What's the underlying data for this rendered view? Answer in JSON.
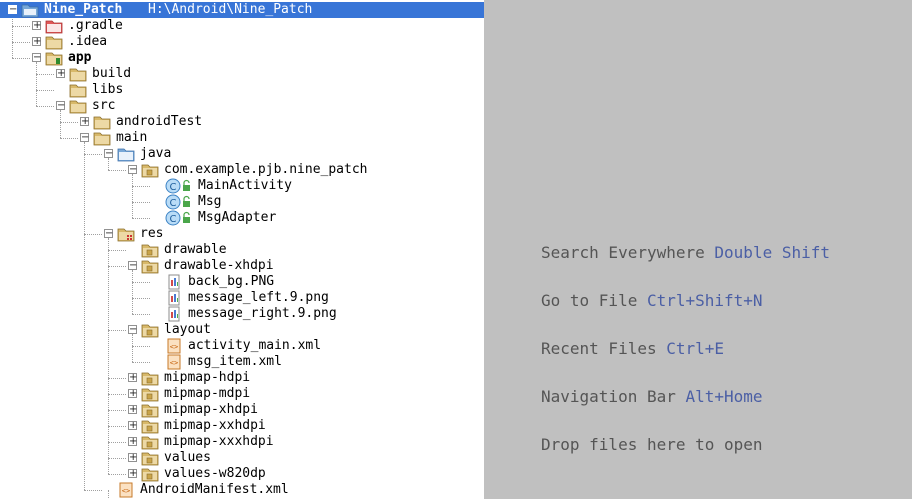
{
  "project": {
    "name": "Nine_Patch",
    "path": "H:\\Android\\Nine_Patch"
  },
  "tree": [
    {
      "label": "Nine_Patch",
      "depth": 0,
      "icon": "project-folder-icon",
      "toggle": "minus",
      "selected": true,
      "bold": true,
      "path": "H:\\Android\\Nine_Patch"
    },
    {
      "label": ".gradle",
      "depth": 1,
      "icon": "folder-red-icon",
      "toggle": "plus"
    },
    {
      "label": ".idea",
      "depth": 1,
      "icon": "folder-icon",
      "toggle": "plus"
    },
    {
      "label": "app",
      "depth": 1,
      "icon": "module-folder-icon",
      "toggle": "minus",
      "bold": true
    },
    {
      "label": "build",
      "depth": 2,
      "icon": "folder-icon",
      "toggle": "plus"
    },
    {
      "label": "libs",
      "depth": 2,
      "icon": "folder-icon",
      "toggle": "none"
    },
    {
      "label": "src",
      "depth": 2,
      "icon": "folder-icon",
      "toggle": "minus"
    },
    {
      "label": "androidTest",
      "depth": 3,
      "icon": "folder-icon",
      "toggle": "plus"
    },
    {
      "label": "main",
      "depth": 3,
      "icon": "folder-icon",
      "toggle": "minus"
    },
    {
      "label": "java",
      "depth": 4,
      "icon": "source-folder-icon",
      "toggle": "minus"
    },
    {
      "label": "com.example.pjb.nine_patch",
      "depth": 5,
      "icon": "package-icon",
      "toggle": "minus"
    },
    {
      "label": "MainActivity",
      "depth": 6,
      "icon": "class-icon",
      "toggle": "none"
    },
    {
      "label": "Msg",
      "depth": 6,
      "icon": "class-icon",
      "toggle": "none"
    },
    {
      "label": "MsgAdapter",
      "depth": 6,
      "icon": "class-icon",
      "toggle": "none"
    },
    {
      "label": "res",
      "depth": 4,
      "icon": "resource-folder-icon",
      "toggle": "minus"
    },
    {
      "label": "drawable",
      "depth": 5,
      "icon": "package-icon",
      "toggle": "none"
    },
    {
      "label": "drawable-xhdpi",
      "depth": 5,
      "icon": "package-icon",
      "toggle": "minus"
    },
    {
      "label": "back_bg.PNG",
      "depth": 6,
      "icon": "image-file-icon",
      "toggle": "none"
    },
    {
      "label": "message_left.9.png",
      "depth": 6,
      "icon": "image-file-icon",
      "toggle": "none"
    },
    {
      "label": "message_right.9.png",
      "depth": 6,
      "icon": "image-file-icon",
      "toggle": "none"
    },
    {
      "label": "layout",
      "depth": 5,
      "icon": "package-icon",
      "toggle": "minus"
    },
    {
      "label": "activity_main.xml",
      "depth": 6,
      "icon": "xml-file-icon",
      "toggle": "none"
    },
    {
      "label": "msg_item.xml",
      "depth": 6,
      "icon": "xml-file-icon",
      "toggle": "none"
    },
    {
      "label": "mipmap-hdpi",
      "depth": 5,
      "icon": "package-icon",
      "toggle": "plus"
    },
    {
      "label": "mipmap-mdpi",
      "depth": 5,
      "icon": "package-icon",
      "toggle": "plus"
    },
    {
      "label": "mipmap-xhdpi",
      "depth": 5,
      "icon": "package-icon",
      "toggle": "plus"
    },
    {
      "label": "mipmap-xxhdpi",
      "depth": 5,
      "icon": "package-icon",
      "toggle": "plus"
    },
    {
      "label": "mipmap-xxxhdpi",
      "depth": 5,
      "icon": "package-icon",
      "toggle": "plus"
    },
    {
      "label": "values",
      "depth": 5,
      "icon": "package-icon",
      "toggle": "plus"
    },
    {
      "label": "values-w820dp",
      "depth": 5,
      "icon": "package-icon",
      "toggle": "plus"
    },
    {
      "label": "AndroidManifest.xml",
      "depth": 4,
      "icon": "xml-file-icon",
      "toggle": "none"
    }
  ],
  "editor": {
    "tips": [
      {
        "text": "Search Everywhere",
        "shortcut": "Double Shift"
      },
      {
        "text": "Go to File",
        "shortcut": "Ctrl+Shift+N"
      },
      {
        "text": "Recent Files",
        "shortcut": "Ctrl+E"
      },
      {
        "text": "Navigation Bar",
        "shortcut": "Alt+Home"
      },
      {
        "text": "Drop files here to open",
        "shortcut": ""
      }
    ]
  },
  "colors": {
    "selection": "#3875d7",
    "editor_bg": "#c0c0c0",
    "tip_text": "#555555",
    "shortcut_text": "#4b5fa5",
    "folder": "#d8b96a",
    "folder_red": "#e05858",
    "source_folder": "#78a8d8"
  }
}
